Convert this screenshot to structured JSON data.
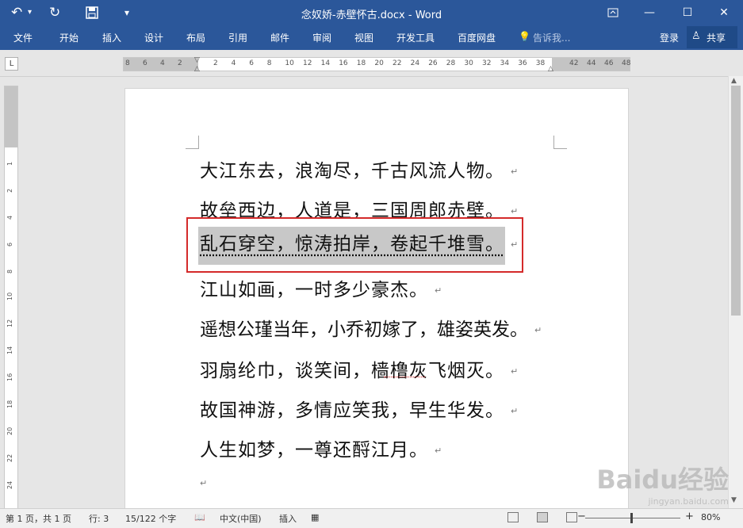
{
  "window": {
    "title": "念奴娇-赤壁怀古.docx - Word",
    "quick_access": {
      "undo_icon": "undo-icon",
      "redo_icon": "repeat-icon",
      "save_icon": "save-icon"
    }
  },
  "ribbon_tabs": [
    "文件",
    "开始",
    "插入",
    "设计",
    "布局",
    "引用",
    "邮件",
    "审阅",
    "视图",
    "开发工具",
    "百度网盘"
  ],
  "tell_me": "告诉我...",
  "sign_in": "登录",
  "share": "共享",
  "ruler": {
    "corner": "L",
    "h_ticks_left": [
      "8",
      "6",
      "4",
      "2"
    ],
    "h_ticks": [
      "2",
      "4",
      "6",
      "8",
      "10",
      "12",
      "14",
      "16",
      "18",
      "20",
      "22",
      "24",
      "26",
      "28",
      "30",
      "32",
      "34",
      "36",
      "38"
    ],
    "h_ticks_right": [
      "42",
      "44",
      "46",
      "48"
    ],
    "v_ticks": [
      "1",
      "2",
      "4",
      "6",
      "8",
      "10",
      "12",
      "14",
      "16",
      "18",
      "20",
      "22",
      "24"
    ]
  },
  "document": {
    "lines": [
      "大江东去，浪淘尽，千古风流人物。",
      "故垒西边，人道是，三国周郎赤壁。",
      "乱石穿空，惊涛拍岸，卷起千堆雪。",
      "江山如画，一时多少豪杰。",
      "遥想公瑾当年，小乔初嫁了，雄姿英发。",
      "羽扇纶巾，谈笑间，樯橹灰飞烟灭。",
      "故国神游，多情应笑我，早生华发。",
      "人生如梦，一尊还酹江月。"
    ],
    "paragraph_mark": "↵",
    "highlighted_line_index": 2,
    "highlight_color": "#c8c8c8",
    "callout_color": "#d42a2a",
    "misspelled_word": "樯橹"
  },
  "status_bar": {
    "page": "第 1 页，共 1 页",
    "line": "行: 3",
    "words": "15/122 个字",
    "language": "中文(中国)",
    "mode": "插入",
    "zoom": "80%"
  },
  "watermark": {
    "logo": "Baidu经验",
    "url": "jingyan.baidu.com"
  },
  "colors": {
    "ribbon": "#2b579a",
    "background": "#e6e6e6"
  }
}
